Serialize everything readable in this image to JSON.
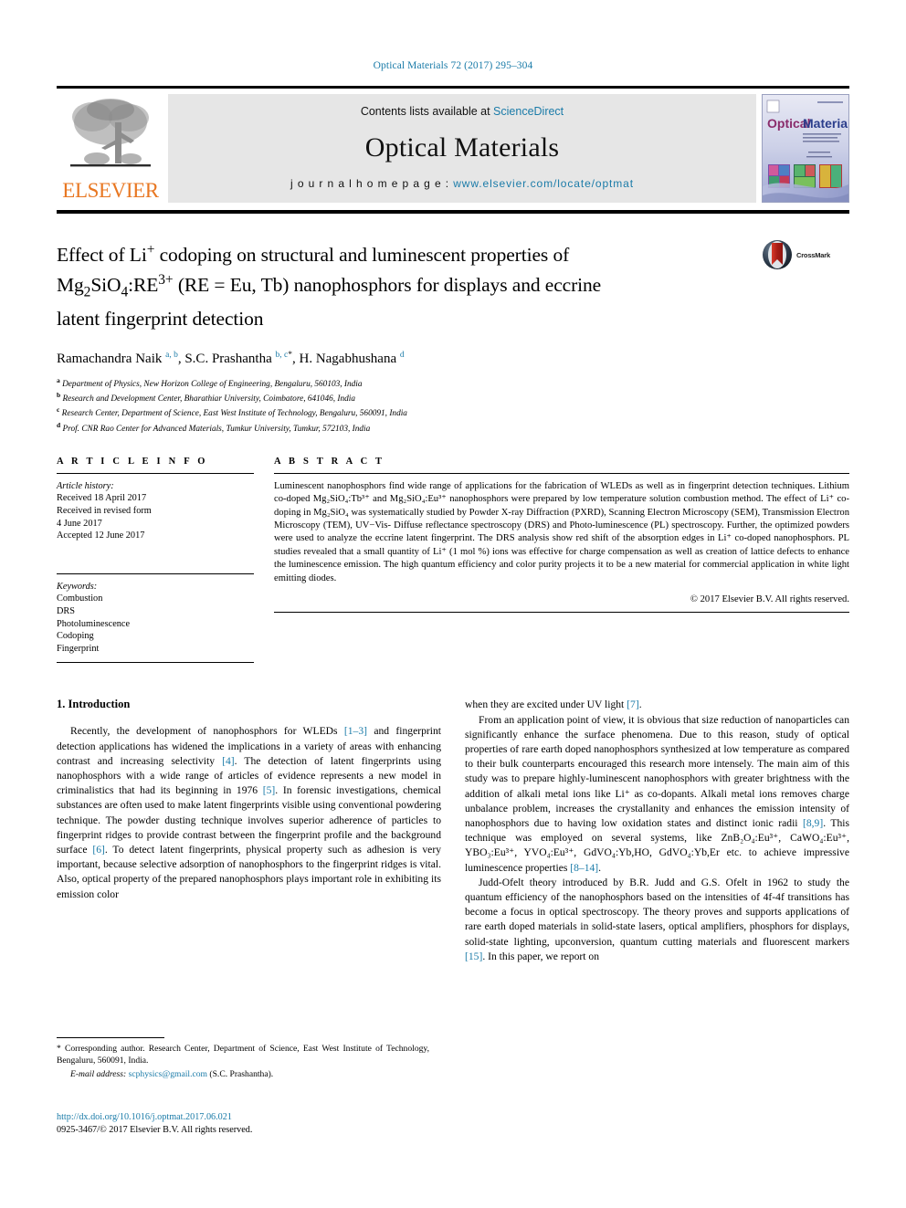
{
  "running_head": "Optical Materials 72 (2017) 295–304",
  "masthead": {
    "publisher_name": "ELSEVIER",
    "contents_prefix": "Contents lists available at ",
    "contents_link": "ScienceDirect",
    "journal_name": "Optical Materials",
    "homepage_prefix": "j o u r n a l   h o m e p a g e :  ",
    "homepage_url": "www.elsevier.com/locate/optmat",
    "cover_title_a": "Optical",
    "cover_title_b": "Materials"
  },
  "title": {
    "line1": "Effect of Li",
    "sup1": "+",
    "line1b": " codoping on structural and luminescent properties of",
    "line2a": "Mg",
    "sub2a": "2",
    "line2b": "SiO",
    "sub2b": "4",
    "line2c": ":RE",
    "sup2c": "3+",
    "line2d": " (RE = Eu, Tb) nanophosphors for displays and eccrine",
    "line3": "latent fingerprint detection",
    "full": "Effect of Li+ codoping on structural and luminescent properties of Mg2SiO4:RE3+ (RE = Eu, Tb) nanophosphors for displays and eccrine latent fingerprint detection"
  },
  "crossmark_label": "CrossMark",
  "authors": [
    {
      "name": "Ramachandra Naik",
      "marks": "a, b",
      "star": false,
      "sep": ", "
    },
    {
      "name": "S.C. Prashantha",
      "marks": "b, c",
      "star": true,
      "sep": ", "
    },
    {
      "name": "H. Nagabhushana",
      "marks": "d",
      "star": false,
      "sep": ""
    }
  ],
  "affiliations": [
    {
      "mark": "a",
      "text": "Department of Physics, New Horizon College of Engineering, Bengaluru, 560103, India"
    },
    {
      "mark": "b",
      "text": "Research and Development Center, Bharathiar University, Coimbatore, 641046, India"
    },
    {
      "mark": "c",
      "text": "Research Center, Department of Science, East West Institute of Technology, Bengaluru, 560091, India"
    },
    {
      "mark": "d",
      "text": "Prof. CNR Rao Center for Advanced Materials, Tumkur University, Tumkur, 572103, India"
    }
  ],
  "article_info": {
    "heading": "A R T I C L E  I N F O",
    "history_label": "Article history:",
    "history_lines": [
      "Received 18 April 2017",
      "Received in revised form",
      "4 June 2017",
      "Accepted 12 June 2017"
    ],
    "keywords_label": "Keywords:",
    "keywords": [
      "Combustion",
      "DRS",
      "Photoluminescence",
      "Codoping",
      "Fingerprint"
    ]
  },
  "abstract": {
    "heading": "A B S T R A C T",
    "text": "Luminescent nanophosphors find wide range of applications for the fabrication of WLEDs as well as in fingerprint detection techniques. Lithium co-doped Mg₂SiO₄:Tb³⁺ and Mg₂SiO₄:Eu³⁺ nanophosphors were prepared by low temperature solution combustion method. The effect of Li⁺ co-doping in Mg₂SiO₄ was systematically studied by Powder X-ray Diffraction (PXRD), Scanning Electron Microscopy (SEM), Transmission Electron Microscopy (TEM), UV−Vis- Diffuse reflectance spectroscopy (DRS) and Photo-luminescence (PL) spectroscopy. Further, the optimized powders were used to analyze the eccrine latent fingerprint. The DRS analysis show red shift of the absorption edges in Li⁺ co-doped nanophosphors. PL studies revealed that a small quantity of Li⁺ (1 mol %) ions was effective for charge compensation as well as creation of lattice defects to enhance the luminescence emission. The high quantum efficiency and color purity projects it to be a new material for commercial application in white light emitting diodes.",
    "copyright": "© 2017 Elsevier B.V. All rights reserved."
  },
  "body": {
    "section_title": "1. Introduction",
    "left_paragraphs": [
      "Recently, the development of nanophosphors for WLEDs [1–3] and fingerprint detection applications has widened the implications in a variety of areas with enhancing contrast and increasing selectivity [4]. The detection of latent fingerprints using nanophosphors with a wide range of articles of evidence represents a new model in criminalistics that had its beginning in 1976 [5]. In forensic investigations, chemical substances are often used to make latent fingerprints visible using conventional powdering technique. The powder dusting technique involves superior adherence of particles to fingerprint ridges to provide contrast between the fingerprint profile and the background surface [6]. To detect latent fingerprints, physical property such as adhesion is very important, because selective adsorption of nanophosphors to the fingerprint ridges is vital. Also, optical property of the prepared nanophosphors plays important role in exhibiting its emission color"
    ],
    "right_paragraphs": [
      "when they are excited under UV light [7].",
      "From an application point of view, it is obvious that size reduction of nanoparticles can significantly enhance the surface phenomena. Due to this reason, study of optical properties of rare earth doped nanophosphors synthesized at low temperature as compared to their bulk counterparts encouraged this research more intensely. The main aim of this study was to prepare highly-luminescent nanophosphors with greater brightness with the addition of alkali metal ions like Li⁺ as co-dopants. Alkali metal ions removes charge unbalance problem, increases the crystallanity and enhances the emission intensity of nanophosphors due to having low oxidation states and distinct ionic radii [8,9]. This technique was employed on several systems, like ZnB₂O₄:Eu³⁺, CaWO₄:Eu³⁺, YBO₃:Eu³⁺, YVO₄:Eu³⁺, GdVO₄:Yb,HO, GdVO₄:Yb,Er etc. to achieve impressive luminescence properties [8–14].",
      "Judd-Ofelt theory introduced by B.R. Judd and G.S. Ofelt in 1962 to study the quantum efficiency of the nanophosphors based on the intensities of 4f-4f transitions has become a focus in optical spectroscopy. The theory proves and supports applications of rare earth doped materials in solid-state lasers, optical amplifiers, phosphors for displays, solid-state lighting, upconversion, quantum cutting materials and fluorescent markers [15]. In this paper, we report on"
    ]
  },
  "footnote": {
    "corresponding": "* Corresponding author. Research Center, Department of Science, East West Institute of Technology, Bengaluru, 560091, India.",
    "email_label": "E-mail address:",
    "email": "scphysics@gmail.com",
    "email_owner": "(S.C. Prashantha)."
  },
  "doi": {
    "url": "http://dx.doi.org/10.1016/j.optmat.2017.06.021",
    "issn_line": "0925-3467/© 2017 Elsevier B.V. All rights reserved."
  },
  "colors": {
    "link": "#1a7ba8",
    "elsevier_orange": "#E87722",
    "banner_gray": "#e6e6e6"
  }
}
